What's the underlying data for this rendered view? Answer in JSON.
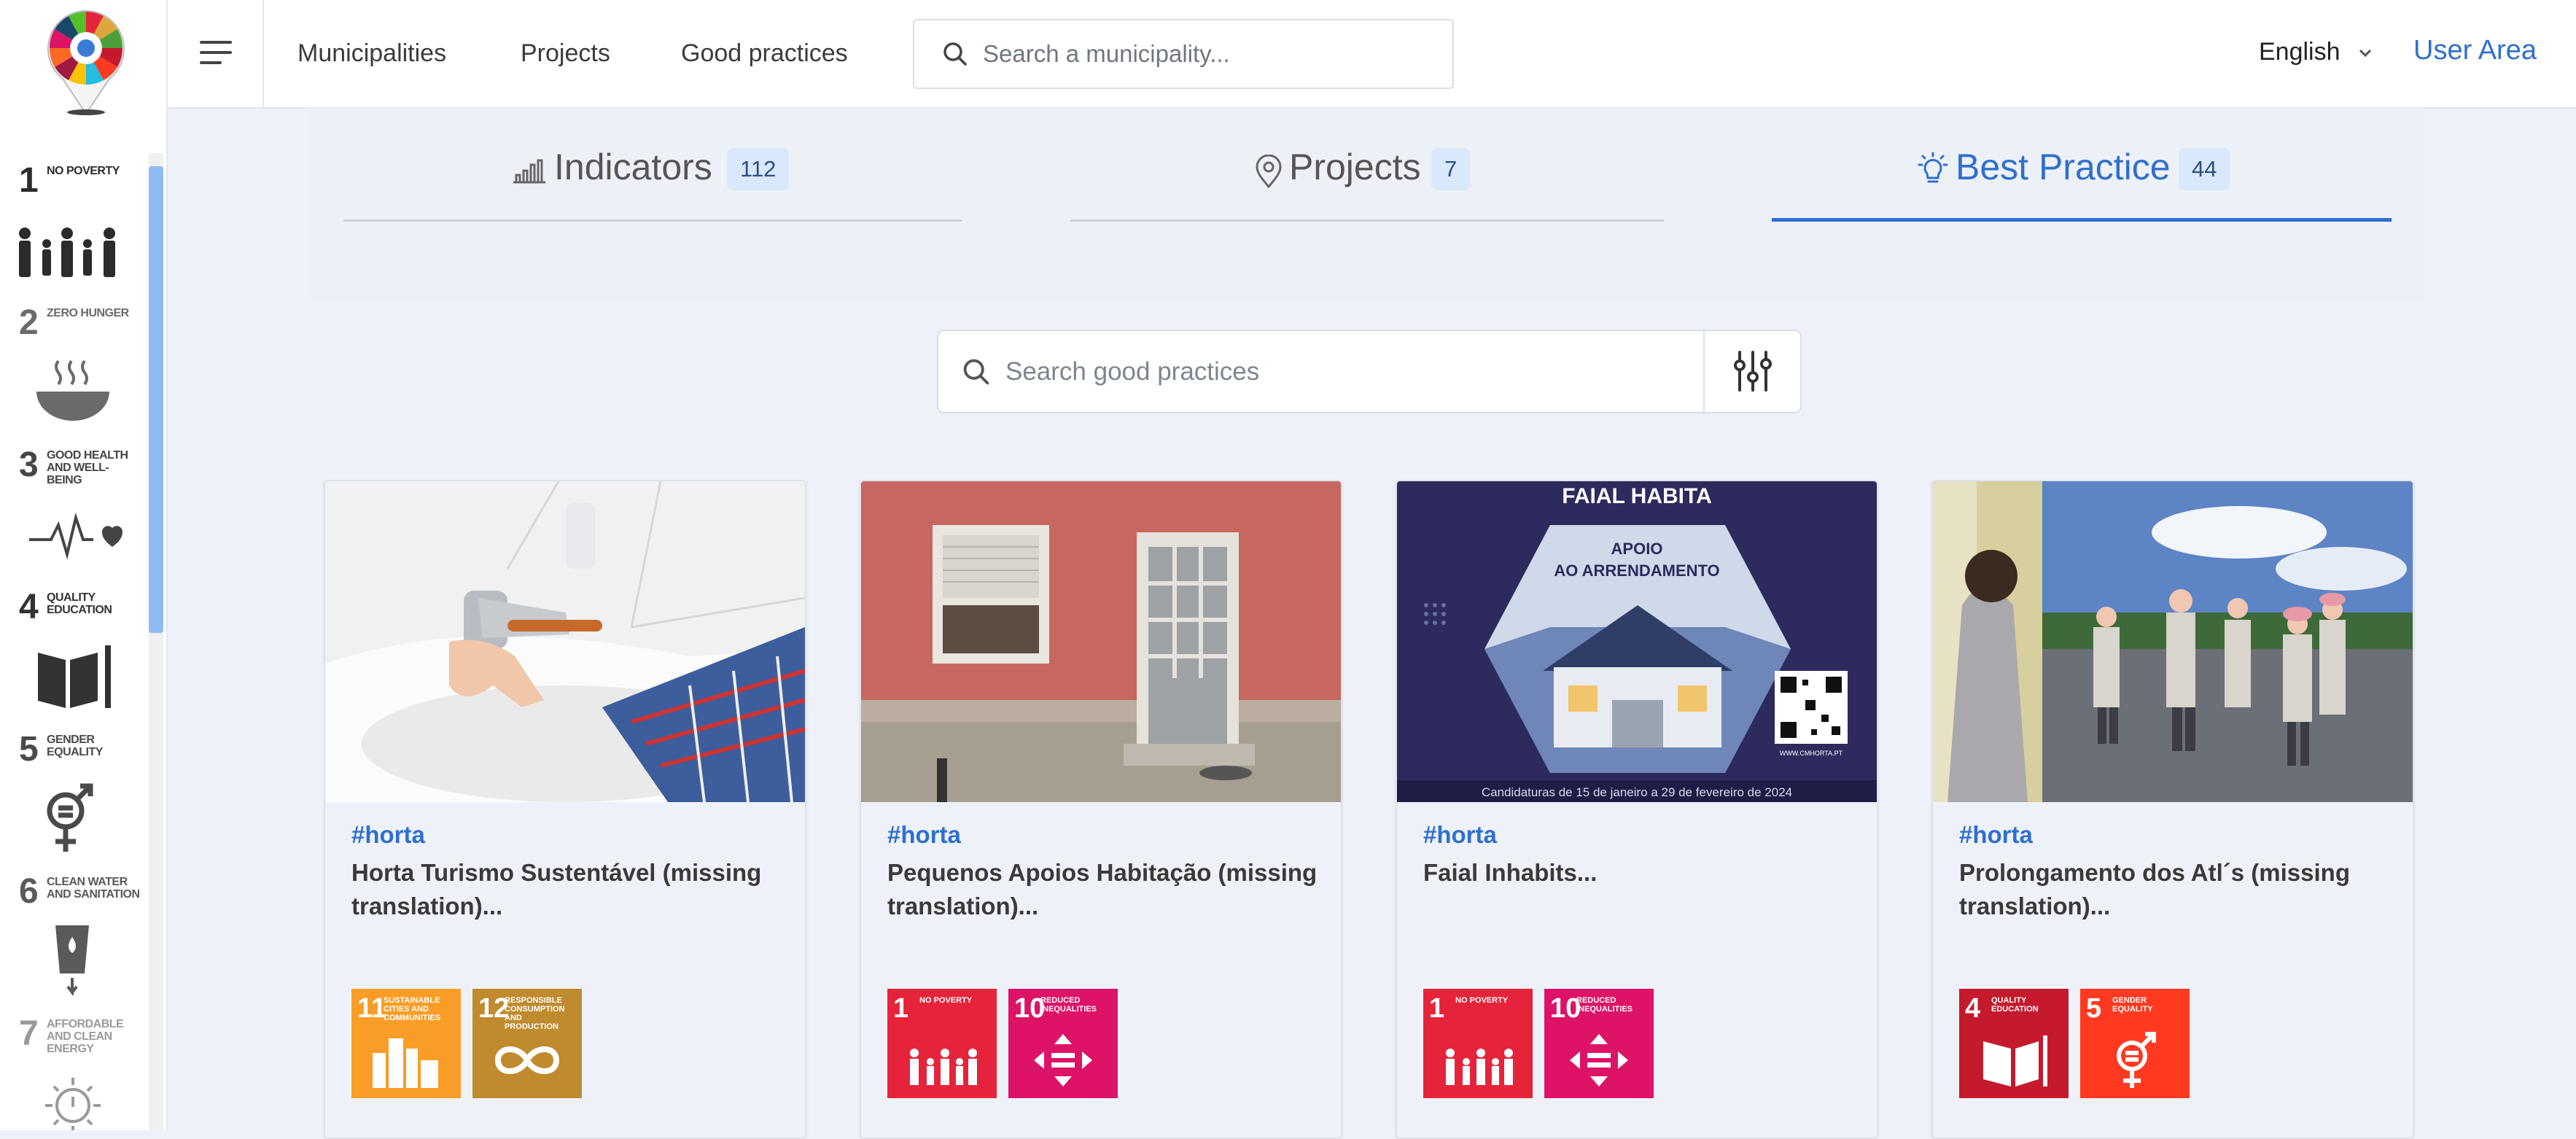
{
  "nav": {
    "links": [
      "Municipalities",
      "Projects",
      "Good practices"
    ],
    "search_placeholder": "Search a municipality...",
    "language": "English",
    "user_area": "User Area"
  },
  "sidebar": {
    "goals": [
      {
        "num": "1",
        "name": "No poverty",
        "color": "#2b2b2b"
      },
      {
        "num": "2",
        "name": "Zero hunger",
        "color": "#6a6a6a"
      },
      {
        "num": "3",
        "name": "Good health and well-being",
        "color": "#454545"
      },
      {
        "num": "4",
        "name": "Quality education",
        "color": "#333333"
      },
      {
        "num": "5",
        "name": "Gender equality",
        "color": "#4a4a4a"
      },
      {
        "num": "6",
        "name": "Clean water and sanitation",
        "color": "#5a5a5a"
      },
      {
        "num": "7",
        "name": "Affordable and clean energy",
        "color": "#9a9a9a"
      }
    ]
  },
  "tabs": [
    {
      "label": "Indicators",
      "count": "112",
      "active": false
    },
    {
      "label": "Projects",
      "count": "7",
      "active": false
    },
    {
      "label": "Best Practice",
      "count": "44",
      "active": true
    }
  ],
  "good_practices_search": {
    "placeholder": "Search good practices"
  },
  "cards": [
    {
      "tag": "#horta",
      "title": "Horta Turismo Sustentável (missing translation)...",
      "sdgs": [
        {
          "num": "11",
          "name": "Sustainable cities and communities",
          "color": "#f99d26"
        },
        {
          "num": "12",
          "name": "Responsible consumption and production",
          "color": "#cf8d2a"
        }
      ]
    },
    {
      "tag": "#horta",
      "title": "Pequenos Apoios Habitação (missing translation)...",
      "sdgs": [
        {
          "num": "1",
          "name": "No poverty",
          "color": "#e5243b"
        },
        {
          "num": "10",
          "name": "Reduced inequalities",
          "color": "#dd1367"
        }
      ]
    },
    {
      "tag": "#horta",
      "title": "Faial Inhabits...",
      "image_text": {
        "title": "FAIAL HABITA",
        "line1": "APOIO",
        "line2": "AO ARRENDAMENTO",
        "site": "WWW.CMHORTA.PT",
        "footer": "Candidaturas de 15 de janeiro a 29 de fevereiro de 2024"
      },
      "sdgs": [
        {
          "num": "1",
          "name": "No poverty",
          "color": "#e5243b"
        },
        {
          "num": "10",
          "name": "Reduced inequalities",
          "color": "#dd1367"
        }
      ]
    },
    {
      "tag": "#horta",
      "title": "Prolongamento dos Atl´s (missing translation)...",
      "sdgs": [
        {
          "num": "4",
          "name": "Quality education",
          "color": "#c5192d"
        },
        {
          "num": "5",
          "name": "Gender equality",
          "color": "#ff3a21"
        }
      ]
    }
  ]
}
